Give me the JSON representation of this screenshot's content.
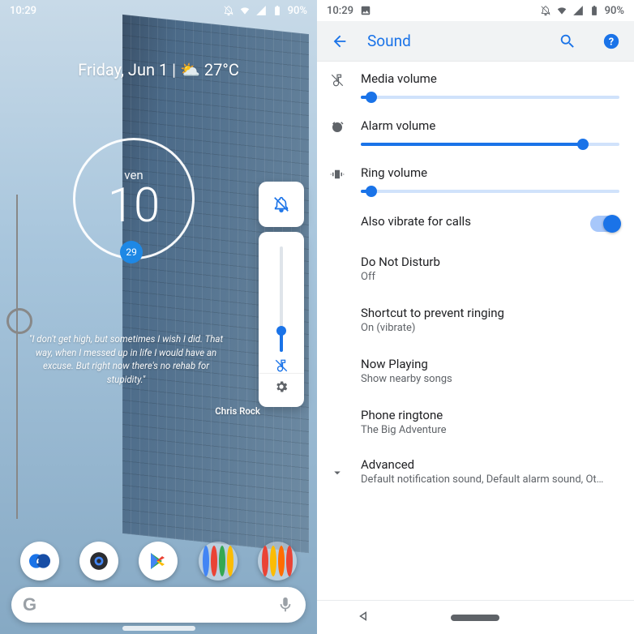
{
  "left": {
    "status": {
      "time": "10:29",
      "battery_pct": "90%"
    },
    "dateline": "Friday, Jun 1  |  ⛅ 27°C",
    "clock": {
      "day_label": "ven",
      "big_date": "10",
      "badge": "29"
    },
    "quote": {
      "text": "\"I don't get high, but sometimes I wish I did. That way, when I messed up in life I would have an excuse. But right now there's no rehab for stupidity.\"",
      "author": "Chris Rock"
    },
    "volume": {
      "level_pct": 20
    }
  },
  "right": {
    "status": {
      "time": "10:29",
      "battery_pct": "90%"
    },
    "header": {
      "title": "Sound"
    },
    "rows": {
      "media": {
        "label": "Media volume",
        "value_pct": 4
      },
      "alarm": {
        "label": "Alarm volume",
        "value_pct": 86
      },
      "ring": {
        "label": "Ring volume",
        "value_pct": 4
      },
      "vibrate": {
        "label": "Also vibrate for calls",
        "on": true
      },
      "dnd": {
        "label": "Do Not Disturb",
        "sub": "Off"
      },
      "shortcut": {
        "label": "Shortcut to prevent ringing",
        "sub": "On (vibrate)"
      },
      "nowplaying": {
        "label": "Now Playing",
        "sub": "Show nearby songs"
      },
      "ringtone": {
        "label": "Phone ringtone",
        "sub": "The Big Adventure"
      },
      "advanced": {
        "label": "Advanced",
        "sub": "Default notification sound, Default alarm sound, Ot…"
      }
    }
  }
}
